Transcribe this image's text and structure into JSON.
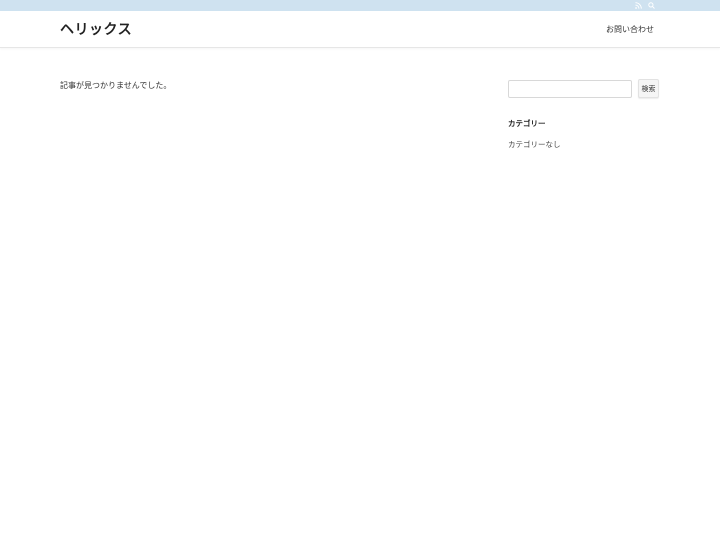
{
  "topbar": {
    "icons": [
      "rss-icon",
      "search-icon"
    ],
    "background": "#cfe2f0"
  },
  "header": {
    "site_title": "ヘリックス",
    "nav": {
      "contact_label": "お問い合わせ"
    }
  },
  "main": {
    "message": "記事が見つかりませんでした。"
  },
  "sidebar": {
    "search": {
      "placeholder": "",
      "value": "",
      "button_label": "検索"
    },
    "categories": {
      "title": "カテゴリー",
      "empty_label": "カテゴリーなし"
    }
  }
}
